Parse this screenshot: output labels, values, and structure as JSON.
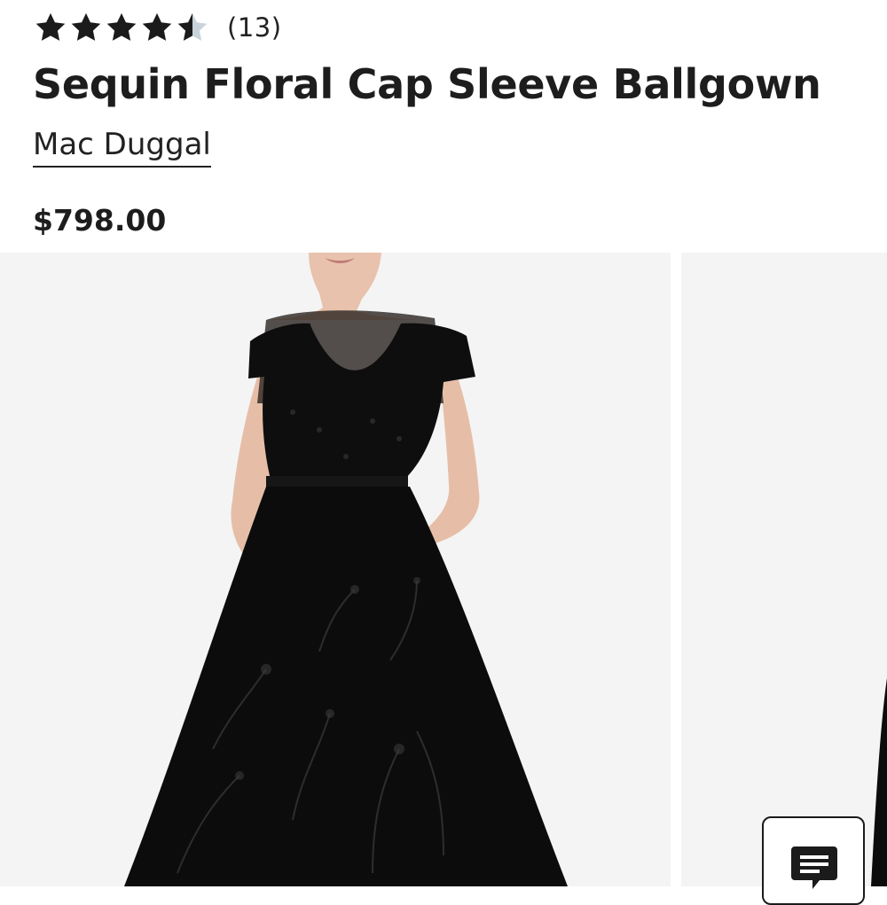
{
  "product": {
    "rating": {
      "value": 4.5,
      "max": 5,
      "review_count_label": "(13)"
    },
    "title": "Sequin Floral Cap Sleeve Ballgown",
    "brand": "Mac Duggal",
    "price": "$798.00"
  },
  "gallery": {
    "images": [
      {
        "icon": "model-in-black-gown-image"
      },
      {
        "icon": "partial-next-image"
      }
    ]
  },
  "chat": {
    "icon": "chat-icon"
  },
  "colors": {
    "star_filled": "#1b1b1b",
    "star_empty": "#c9d3da",
    "image_bg": "#f4f4f4",
    "gown": "#0d0d0d"
  }
}
